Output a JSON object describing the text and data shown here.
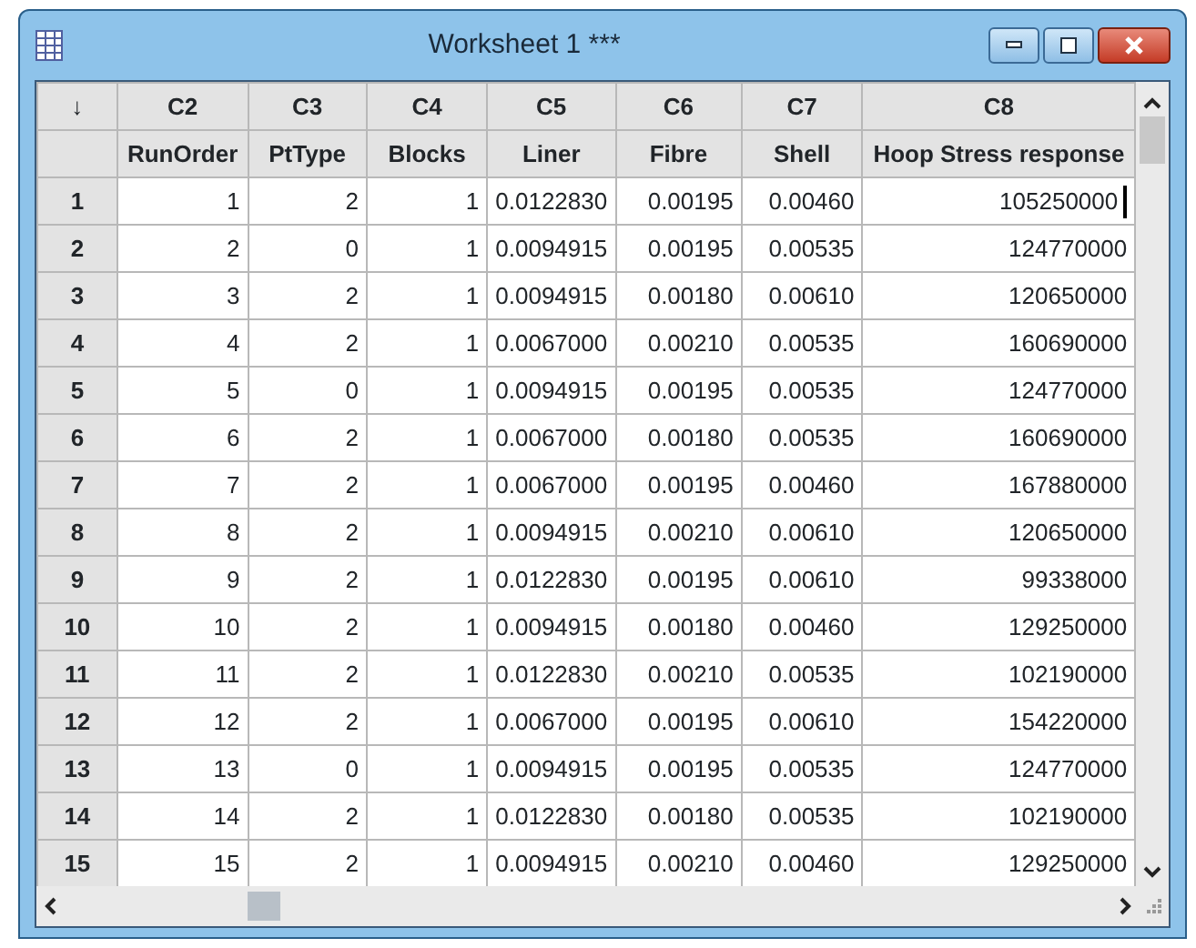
{
  "window": {
    "title": "Worksheet 1 ***"
  },
  "corner": "↓",
  "columns": [
    {
      "id": "C2",
      "name": "RunOrder"
    },
    {
      "id": "C3",
      "name": "PtType"
    },
    {
      "id": "C4",
      "name": "Blocks"
    },
    {
      "id": "C5",
      "name": "Liner"
    },
    {
      "id": "C6",
      "name": "Fibre"
    },
    {
      "id": "C7",
      "name": "Shell"
    },
    {
      "id": "C8",
      "name": "Hoop Stress response"
    }
  ],
  "rows": [
    {
      "num": "1",
      "cells": [
        "1",
        "2",
        "1",
        "0.0122830",
        "0.00195",
        "0.00460",
        "105250000"
      ],
      "active": true
    },
    {
      "num": "2",
      "cells": [
        "2",
        "0",
        "1",
        "0.0094915",
        "0.00195",
        "0.00535",
        "124770000"
      ],
      "active": false
    },
    {
      "num": "3",
      "cells": [
        "3",
        "2",
        "1",
        "0.0094915",
        "0.00180",
        "0.00610",
        "120650000"
      ],
      "active": false
    },
    {
      "num": "4",
      "cells": [
        "4",
        "2",
        "1",
        "0.0067000",
        "0.00210",
        "0.00535",
        "160690000"
      ],
      "active": false
    },
    {
      "num": "5",
      "cells": [
        "5",
        "0",
        "1",
        "0.0094915",
        "0.00195",
        "0.00535",
        "124770000"
      ],
      "active": false
    },
    {
      "num": "6",
      "cells": [
        "6",
        "2",
        "1",
        "0.0067000",
        "0.00180",
        "0.00535",
        "160690000"
      ],
      "active": false
    },
    {
      "num": "7",
      "cells": [
        "7",
        "2",
        "1",
        "0.0067000",
        "0.00195",
        "0.00460",
        "167880000"
      ],
      "active": false
    },
    {
      "num": "8",
      "cells": [
        "8",
        "2",
        "1",
        "0.0094915",
        "0.00210",
        "0.00610",
        "120650000"
      ],
      "active": false
    },
    {
      "num": "9",
      "cells": [
        "9",
        "2",
        "1",
        "0.0122830",
        "0.00195",
        "0.00610",
        "99338000"
      ],
      "active": false
    },
    {
      "num": "10",
      "cells": [
        "10",
        "2",
        "1",
        "0.0094915",
        "0.00180",
        "0.00460",
        "129250000"
      ],
      "active": false
    },
    {
      "num": "11",
      "cells": [
        "11",
        "2",
        "1",
        "0.0122830",
        "0.00210",
        "0.00535",
        "102190000"
      ],
      "active": false
    },
    {
      "num": "12",
      "cells": [
        "12",
        "2",
        "1",
        "0.0067000",
        "0.00195",
        "0.00610",
        "154220000"
      ],
      "active": false
    },
    {
      "num": "13",
      "cells": [
        "13",
        "0",
        "1",
        "0.0094915",
        "0.00195",
        "0.00535",
        "124770000"
      ],
      "active": false
    },
    {
      "num": "14",
      "cells": [
        "14",
        "2",
        "1",
        "0.0122830",
        "0.00180",
        "0.00535",
        "102190000"
      ],
      "active": false
    },
    {
      "num": "15",
      "cells": [
        "15",
        "2",
        "1",
        "0.0094915",
        "0.00210",
        "0.00460",
        "129250000"
      ],
      "active": false
    }
  ]
}
